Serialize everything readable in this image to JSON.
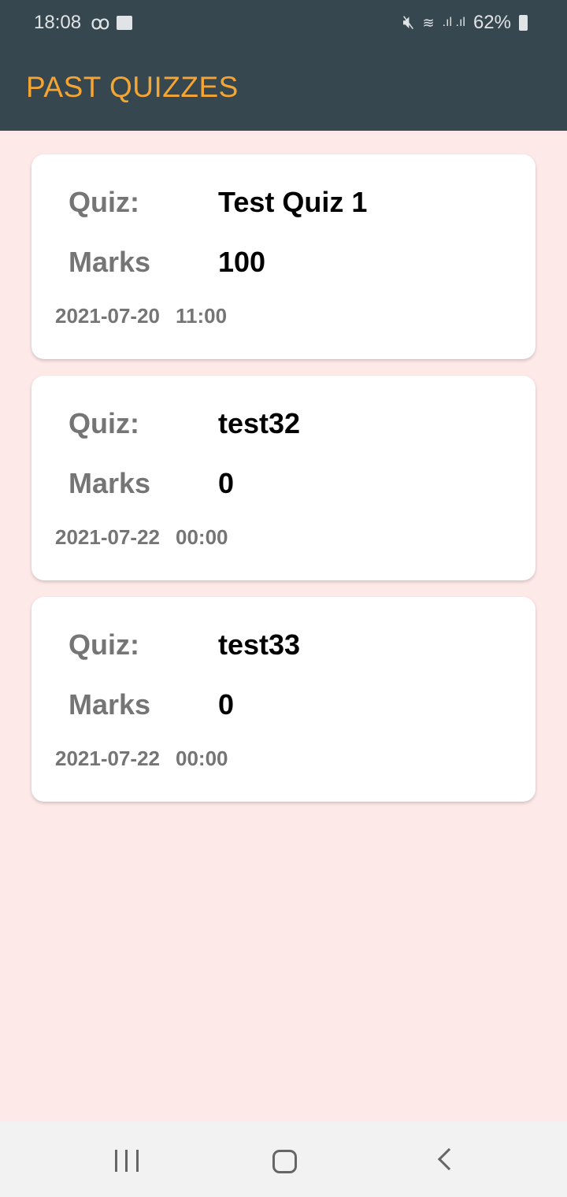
{
  "status_bar": {
    "time": "18:08",
    "battery": "62%"
  },
  "header": {
    "title": "PAST QUIZZES"
  },
  "labels": {
    "quiz": "Quiz:",
    "marks": "Marks"
  },
  "quizzes": [
    {
      "name": "Test Quiz 1",
      "marks": "100",
      "date": "2021-07-20",
      "time": "11:00"
    },
    {
      "name": "test32",
      "marks": "0",
      "date": "2021-07-22",
      "time": "00:00"
    },
    {
      "name": "test33",
      "marks": "0",
      "date": "2021-07-22",
      "time": "00:00"
    }
  ]
}
